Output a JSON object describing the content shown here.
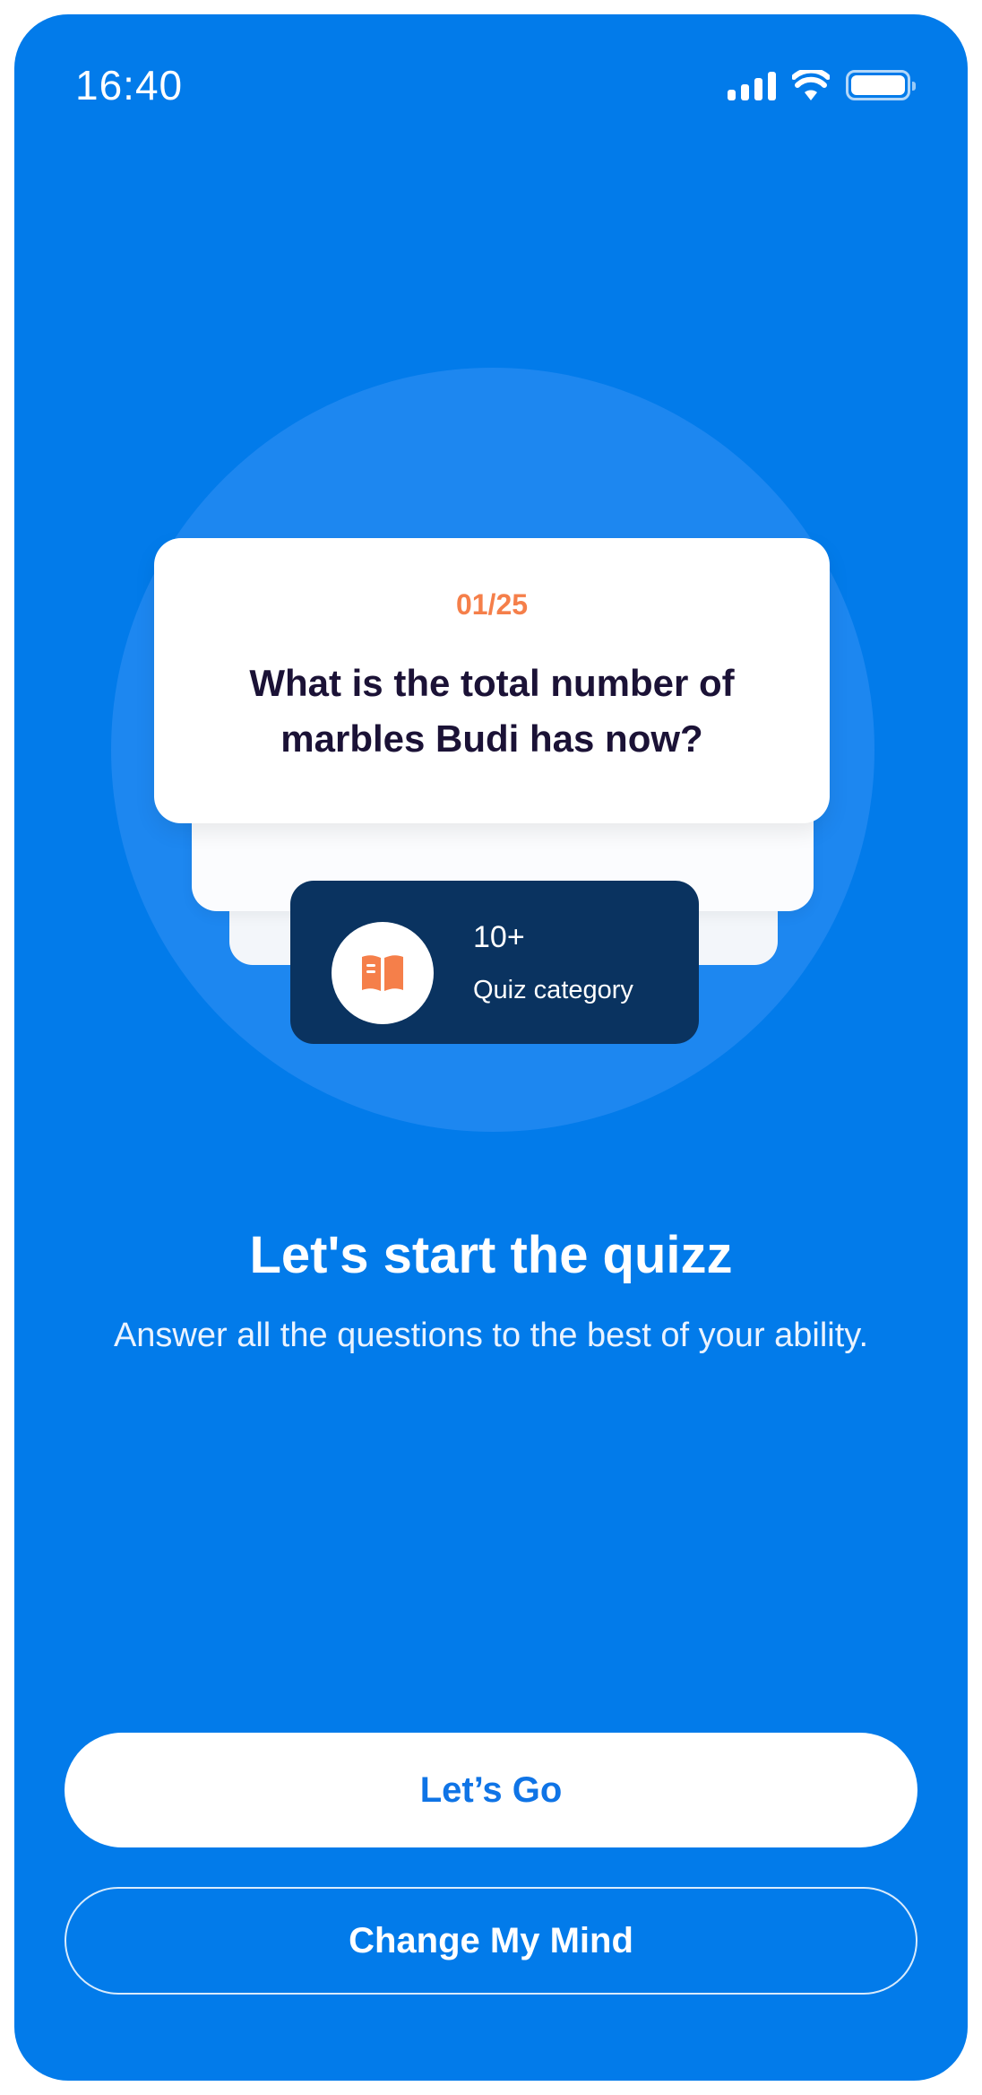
{
  "status_bar": {
    "time": "16:40",
    "icons": [
      "signal-icon",
      "wifi-icon",
      "battery-icon"
    ]
  },
  "question_card": {
    "counter": "01/25",
    "question": "What is the total number of marbles Budi has now?"
  },
  "category_card": {
    "icon": "book-icon",
    "count": "10+",
    "label": "Quiz category"
  },
  "intro": {
    "headline": "Let's start the quizz",
    "subtitle": "Answer all the questions to the best of your ability."
  },
  "actions": {
    "primary_label": "Let’s Go",
    "secondary_label": "Change My Mind"
  },
  "colors": {
    "background": "#027bea",
    "accent_orange": "#f57f4a",
    "category_card": "#0a3360",
    "question_text": "#1b1236"
  }
}
